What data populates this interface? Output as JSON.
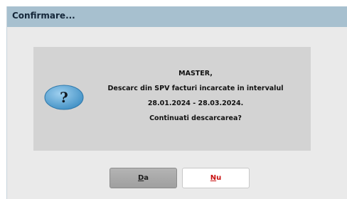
{
  "window": {
    "title": "Confirmare..."
  },
  "dialog": {
    "icon": "question-icon",
    "icon_glyph": "?",
    "message_lines": [
      "MASTER,",
      "Descarc din SPV facturi incarcate in intervalul",
      "28.01.2024 - 28.03.2024.",
      "Continuati descarcarea?"
    ]
  },
  "buttons": {
    "yes": {
      "accel": "D",
      "rest": "a"
    },
    "no": {
      "accel": "N",
      "rest": "u"
    }
  },
  "colors": {
    "titlebar": "#a7c0cf",
    "dialog_bg": "#eaeaea",
    "panel_bg": "#d3d3d3",
    "icon_fill": "#5fa9d8",
    "no_label": "#c81010"
  }
}
